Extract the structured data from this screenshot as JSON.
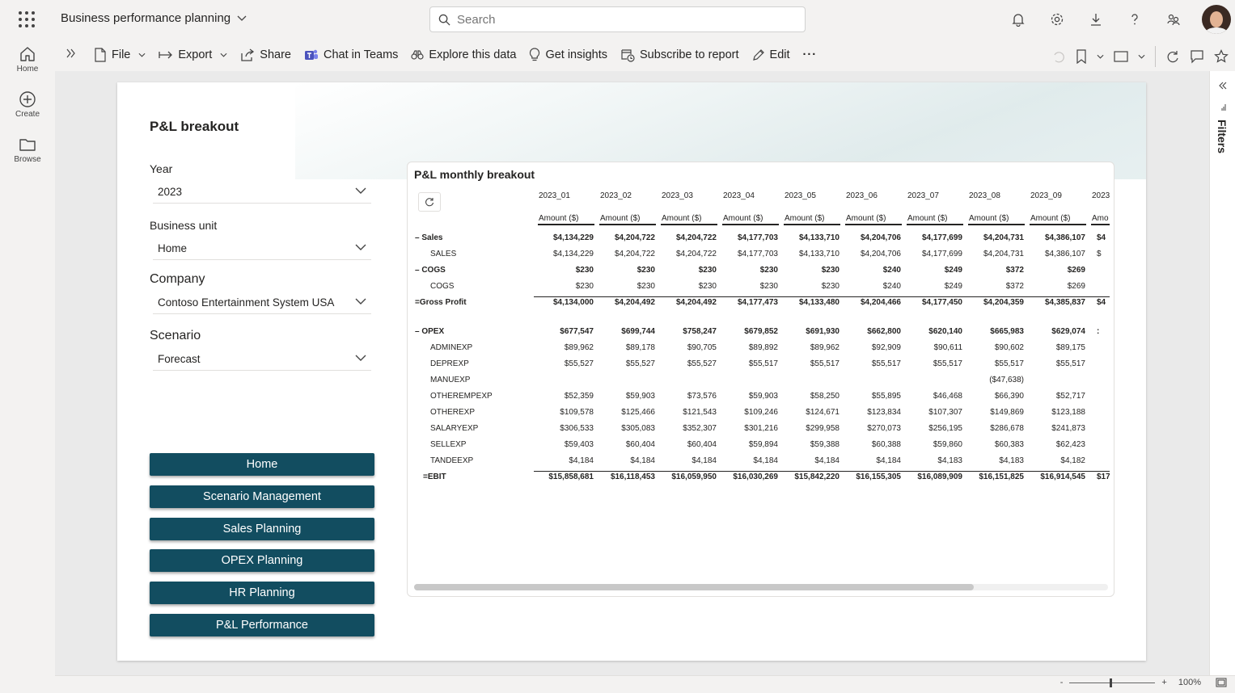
{
  "header": {
    "app_title": "Business performance planning",
    "search_placeholder": "Search"
  },
  "leftnav": [
    {
      "label": "Home",
      "icon": "home-icon"
    },
    {
      "label": "Create",
      "icon": "create-icon"
    },
    {
      "label": "Browse",
      "icon": "folder-icon"
    }
  ],
  "toolbar": {
    "file": "File",
    "export": "Export",
    "share": "Share",
    "chat_in_teams": "Chat in Teams",
    "explore": "Explore this data",
    "insights": "Get insights",
    "subscribe": "Subscribe to report",
    "edit": "Edit",
    "more": "···"
  },
  "page": {
    "title": "P&L breakout",
    "slicers": {
      "year": {
        "label": "Year",
        "value": "2023"
      },
      "business_unit": {
        "label": "Business unit",
        "value": "Home"
      },
      "company": {
        "label": "Company",
        "value": "Contoso Entertainment System USA"
      },
      "scenario": {
        "label": "Scenario",
        "value": "Forecast"
      }
    },
    "nav_buttons": [
      "Home",
      "Scenario Management",
      "Sales Planning",
      "OPEX Planning",
      "HR Planning",
      "P&L Performance"
    ]
  },
  "matrix": {
    "title": "P&L monthly breakout",
    "columns": [
      "2023_01",
      "2023_02",
      "2023_03",
      "2023_04",
      "2023_05",
      "2023_06",
      "2023_07",
      "2023_08",
      "2023_09",
      "2023"
    ],
    "measure_header": "Amount ($)",
    "measure_header_partial": "Amo",
    "rows": [
      {
        "label": "– Sales",
        "bold": true,
        "indent": 0,
        "values": [
          "$4,134,229",
          "$4,204,722",
          "$4,204,722",
          "$4,177,703",
          "$4,133,710",
          "$4,204,706",
          "$4,177,699",
          "$4,204,731",
          "$4,386,107",
          "$4"
        ]
      },
      {
        "label": "SALES",
        "bold": false,
        "indent": 1,
        "values": [
          "$4,134,229",
          "$4,204,722",
          "$4,204,722",
          "$4,177,703",
          "$4,133,710",
          "$4,204,706",
          "$4,177,699",
          "$4,204,731",
          "$4,386,107",
          "$"
        ]
      },
      {
        "label": "– COGS",
        "bold": true,
        "indent": 0,
        "values": [
          "$230",
          "$230",
          "$230",
          "$230",
          "$230",
          "$240",
          "$249",
          "$372",
          "$269",
          ""
        ]
      },
      {
        "label": "COGS",
        "bold": false,
        "indent": 1,
        "values": [
          "$230",
          "$230",
          "$230",
          "$230",
          "$230",
          "$240",
          "$249",
          "$372",
          "$269",
          ""
        ]
      },
      {
        "label": "=Gross Profit",
        "bold": true,
        "indent": 0,
        "values": [
          "$4,134,000",
          "$4,204,492",
          "$4,204,492",
          "$4,177,473",
          "$4,133,480",
          "$4,204,466",
          "$4,177,450",
          "$4,204,359",
          "$4,385,837",
          "$4"
        ]
      },
      {
        "label": "– OPEX",
        "bold": true,
        "indent": 0,
        "values": [
          "$677,547",
          "$699,744",
          "$758,247",
          "$679,852",
          "$691,930",
          "$662,800",
          "$620,140",
          "$665,983",
          "$629,074",
          ":"
        ]
      },
      {
        "label": "ADMINEXP",
        "bold": false,
        "indent": 1,
        "values": [
          "$89,962",
          "$89,178",
          "$90,705",
          "$89,892",
          "$89,962",
          "$92,909",
          "$90,611",
          "$90,602",
          "$89,175",
          ""
        ]
      },
      {
        "label": "DEPREXP",
        "bold": false,
        "indent": 1,
        "values": [
          "$55,527",
          "$55,527",
          "$55,527",
          "$55,517",
          "$55,517",
          "$55,517",
          "$55,517",
          "$55,517",
          "$55,517",
          ""
        ]
      },
      {
        "label": "MANUEXP",
        "bold": false,
        "indent": 1,
        "values": [
          "",
          "",
          "",
          "",
          "",
          "",
          "",
          "($47,638)",
          "",
          ""
        ]
      },
      {
        "label": "OTHEREMPEXP",
        "bold": false,
        "indent": 1,
        "values": [
          "$52,359",
          "$59,903",
          "$73,576",
          "$59,903",
          "$58,250",
          "$55,895",
          "$46,468",
          "$66,390",
          "$52,717",
          ""
        ]
      },
      {
        "label": "OTHEREXP",
        "bold": false,
        "indent": 1,
        "values": [
          "$109,578",
          "$125,466",
          "$121,543",
          "$109,246",
          "$124,671",
          "$123,834",
          "$107,307",
          "$149,869",
          "$123,188",
          ""
        ]
      },
      {
        "label": "SALARYEXP",
        "bold": false,
        "indent": 1,
        "values": [
          "$306,533",
          "$305,083",
          "$352,307",
          "$301,216",
          "$299,958",
          "$270,073",
          "$256,195",
          "$286,678",
          "$241,873",
          ""
        ]
      },
      {
        "label": "SELLEXP",
        "bold": false,
        "indent": 1,
        "values": [
          "$59,403",
          "$60,404",
          "$60,404",
          "$59,894",
          "$59,388",
          "$60,388",
          "$59,860",
          "$60,383",
          "$62,423",
          ""
        ]
      },
      {
        "label": "TANDEEXP",
        "bold": false,
        "indent": 1,
        "values": [
          "$4,184",
          "$4,184",
          "$4,184",
          "$4,184",
          "$4,184",
          "$4,184",
          "$4,183",
          "$4,183",
          "$4,182",
          ""
        ]
      },
      {
        "label": "=EBIT",
        "bold": true,
        "indent": 0,
        "values": [
          "$15,858,681",
          "$16,118,453",
          "$16,059,950",
          "$16,030,269",
          "$15,842,220",
          "$16,155,305",
          "$16,089,909",
          "$16,151,825",
          "$16,914,545",
          "$17"
        ]
      }
    ]
  },
  "filters_pane": {
    "label": "Filters"
  },
  "footer": {
    "zoom": "100%",
    "zoom_minus": "-",
    "zoom_plus": "+"
  }
}
